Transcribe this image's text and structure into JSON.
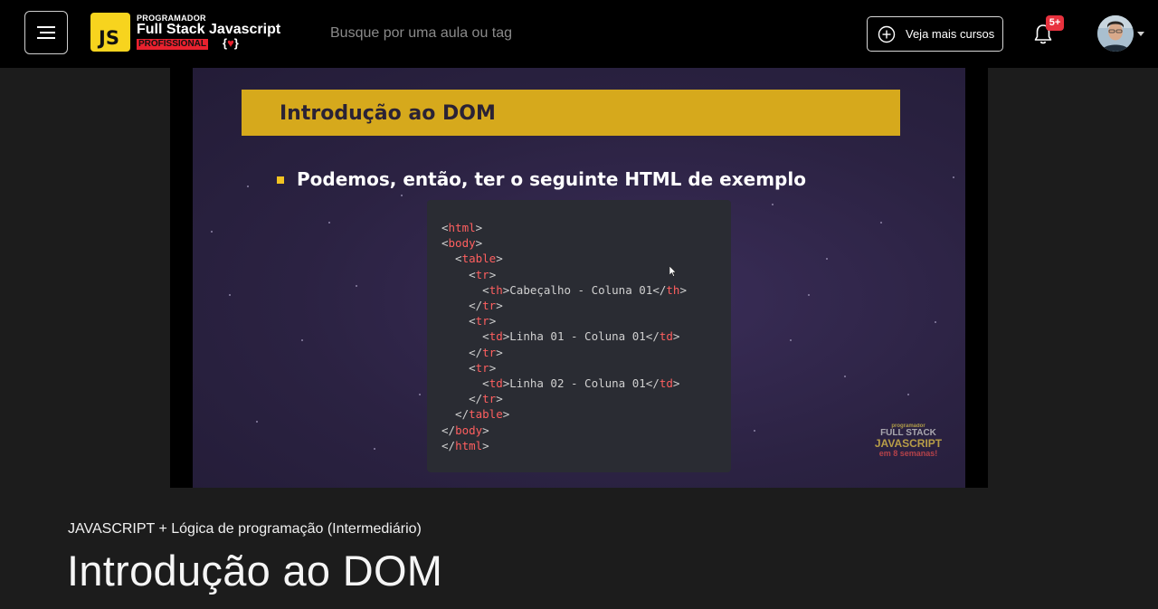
{
  "header": {
    "logo": {
      "badge": "JS",
      "line1": "PROGRAMADOR",
      "line2": "Full Stack Javascript",
      "line3": "PROFISSIONAL",
      "brace_open": "{",
      "brace_mark": "♥",
      "brace_close": "}"
    },
    "search_placeholder": "Busque por uma aula ou tag",
    "more_courses_label": "Veja mais cursos",
    "notifications_count": "5+"
  },
  "video": {
    "slide_title": "Introdução ao DOM",
    "bullet": "Podemos, então, ter o seguinte HTML de exemplo",
    "code_lines": [
      "<html>",
      "<body>",
      "  <table>",
      "    <tr>",
      "      <th>Cabeçalho - Coluna 01</th>",
      "    </tr>",
      "    <tr>",
      "      <td>Linha 01 - Coluna 01</td>",
      "    </tr>",
      "    <tr>",
      "      <td>Linha 02 - Coluna 01</td>",
      "    </tr>",
      "  </table>",
      "</body>",
      "</html>"
    ],
    "watermark": {
      "line1": "programador",
      "line2": "FULL STACK",
      "line3": "JAVASCRIPT",
      "line4": "em 8 semanas!"
    }
  },
  "lesson": {
    "course_name": "JAVASCRIPT + Lógica de programação (Intermediário)",
    "title": "Introdução ao DOM"
  },
  "colors": {
    "accent_yellow": "#f7d41e",
    "accent_red": "#e8212e",
    "badge_red": "#e8323e"
  }
}
